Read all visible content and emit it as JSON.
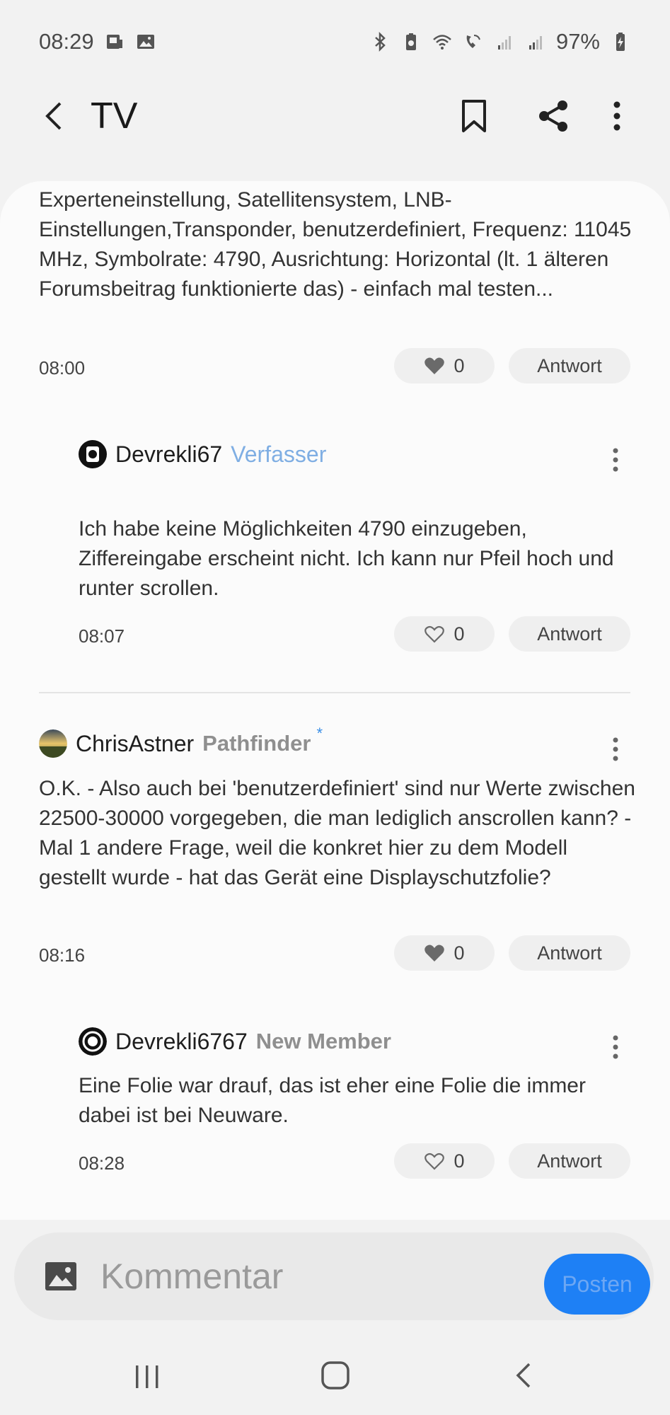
{
  "status_bar": {
    "time": "08:29",
    "battery": "97%"
  },
  "app_bar": {
    "title": "TV"
  },
  "comments": [
    {
      "text": "Experteneinstellung, Satellitensystem, LNB-Einstellungen,Transponder, benutzerdefiniert, Frequenz: 11045 MHz, Symbolrate: 4790, Ausrichtung: Horizontal (lt. 1 älteren Forumsbeitrag funktionierte das) - einfach mal testen...",
      "time": "08:00",
      "likes": "0",
      "reply_label": "Antwort"
    },
    {
      "author": "Devrekli67",
      "badge": "Verfasser",
      "text": "Ich habe keine Möglichkeiten 4790 einzugeben, Ziffereingabe erscheint nicht. Ich kann nur Pfeil hoch und runter scrollen.",
      "time": "08:07",
      "likes": "0",
      "reply_label": "Antwort"
    },
    {
      "author": "ChrisAstner",
      "badge": "Pathfinder",
      "badge_star": "*",
      "text": "O.K. - Also auch bei 'benutzerdefiniert' sind nur Werte zwischen 22500-30000 vorgegeben, die man lediglich anscrollen kann? - Mal 1 andere Frage, weil die konkret hier zu dem Modell gestellt wurde - hat das Gerät eine Displayschutzfolie?",
      "time": "08:16",
      "likes": "0",
      "reply_label": "Antwort"
    },
    {
      "author": "Devrekli6767",
      "badge": "New Member",
      "text": "Eine Folie war drauf, das ist eher eine Folie die immer dabei ist bei Neuware.",
      "time": "08:28",
      "likes": "0",
      "reply_label": "Antwort"
    }
  ],
  "composer": {
    "placeholder": "Kommentar",
    "post_label": "Posten"
  },
  "colors": {
    "accent": "#1e80f5",
    "op_badge": "#7faee3",
    "rank_badge": "#8f8f8f"
  }
}
